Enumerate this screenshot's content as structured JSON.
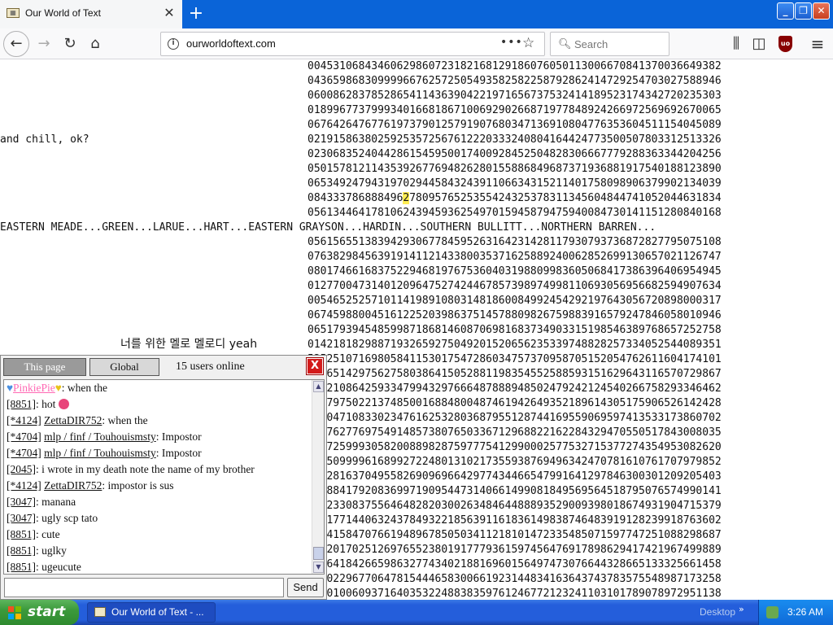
{
  "browser": {
    "tab_title": "Our World of Text",
    "tab_close": "✕",
    "new_tab": "+",
    "url": "ourworldoftext.com",
    "search_placeholder": "Search",
    "page_actions": "•••"
  },
  "page": {
    "chill_text": "and chill, ok?",
    "county_line": "EASTERN MEADE...GREEN...LARUE...HART...EASTERN GRAYSON...HARDIN...SOUTHERN BULLITT...NORTHERN BARREN...",
    "korean_line": "너를 위한 멜로 멜로디 yeah",
    "digit_rows": [
      "00453106843460629860723182168129186076050113006670841370036649382",
      "04365986830999966762572505493582582258792862414729254703027588946",
      "06008628378528654114363904221971656737532414189523174342720235303",
      "01899677379993401668186710069290266871977848924266972569692670065",
      "06764264767761973790125791907680347136910804776353604511154045089",
      "02191586380259253572567612220333240804164424773500507803312513326",
      "02306835240442861545950017400928452504828306667779288363344204256",
      "05015781211435392677694826280155886849687371936881917540188123890",
      "06534924794319702944584324391106634315211401758098906379902134039",
      "08433378688849627809576525355424325378311345604844741052044631834",
      "05613446417810624394593625497015945879475940084730141151280840168",
      null,
      "05615655138394293067784595263164231428117930793736872827795075108",
      "07638298456391914112143380035371625889240062852699130657021126747",
      "08017466168375229468197675360403198809983605068417386396406954945",
      "01277004731401209647527424467857398974998110693056956682594907634",
      "00546525257101141989108031481860084992454292197643056720898000317",
      "06745988004516122520398637514578809826759883916579247846058010946",
      "06517939454859987186814608706981683734903315198546389768657252758",
      "01421818298871932659275049201520656235339748828257334052544089351",
      "52525107169805841153017547286034757370958705152054762611604174101",
      "13865142975627580386415052881198354552588593151629643116570729867",
      "02921086425933479943297666487888948502479242124540266758293346462",
      "55379750221374850016884800487461942649352189614305175906526142428",
      "53304710833023476162532803687955128744169559069597413533173860702",
      "71876277697549148573807650336712968822162284329470550517843008035",
      "51672599930582008898287597775412990002577532715377274354953082620",
      "54350999961689927224801310217355938769496342470781610761707979852",
      "29228163704955826909696642977434466547991641297846300301209205403",
      "21188417920836997190954473140661499081849569564518795076574990141",
      "90023308375564648282030026348464488893529009398018674931904715379",
      "03217714406324378493221856391161836149838746483919128239918763602",
      "63341584707661948967850503411218101472335485071597747251088298687",
      "80020170251269765523801917779361597456476917898629417421967499889",
      "95364184266598632774340218816960156497473076644328665133325661458",
      "57602296770647815444658300661923144834163643743783575548987173258",
      "88901006093716403532248838359761246772123241103101789078972951138"
    ],
    "highlight_row_prefix": "084333786888496",
    "highlight_char": "2",
    "highlight_row_suffix": "7809576525355424325378311345604844741052044631834"
  },
  "chat": {
    "tab_this_page": "This page",
    "tab_global": "Global",
    "users_online": "15 users online",
    "close": "X",
    "messages": [
      {
        "id": "",
        "nick": "PinkiePie",
        "text": ": when the",
        "special": "pinkie"
      },
      {
        "id": "[8851]",
        "nick": "",
        "text": ": hot",
        "special": "emoji"
      },
      {
        "id": "[*4124]",
        "nick": "ZettaDIR752",
        "text": ": when the"
      },
      {
        "id": "[*4704]",
        "nick": "mlp / finf / Touhouismsty",
        "text": ": Impostor"
      },
      {
        "id": "[*4704]",
        "nick": "mlp / finf / Touhouismsty",
        "text": ": Impostor"
      },
      {
        "id": "[2045]",
        "nick": "",
        "text": ": i wrote in my death note the name of my brother"
      },
      {
        "id": "[*4124]",
        "nick": "ZettaDIR752",
        "text": ": impostor is sus"
      },
      {
        "id": "[3047]",
        "nick": "",
        "text": ": manana"
      },
      {
        "id": "[3047]",
        "nick": "",
        "text": ": ugly scp tato"
      },
      {
        "id": "[8851]",
        "nick": "",
        "text": ": cute"
      },
      {
        "id": "[8851]",
        "nick": "",
        "text": ": uglky"
      },
      {
        "id": "[8851]",
        "nick": "",
        "text": ": ugeucute"
      }
    ],
    "input_value": "",
    "send_label": "Send"
  },
  "taskbar": {
    "start_label": "start",
    "task_label": "Our World of Text - ...",
    "desktop_label": "Desktop",
    "desktop_chevron": "»",
    "clock": "3:26 AM"
  },
  "colors": {
    "accent_blue": "#0a64d8",
    "xp_taskbar": "#245edb",
    "start_green": "#3c9a3c",
    "highlight_yellow": "#ffee55",
    "chat_close_red": "#d31b1b"
  }
}
